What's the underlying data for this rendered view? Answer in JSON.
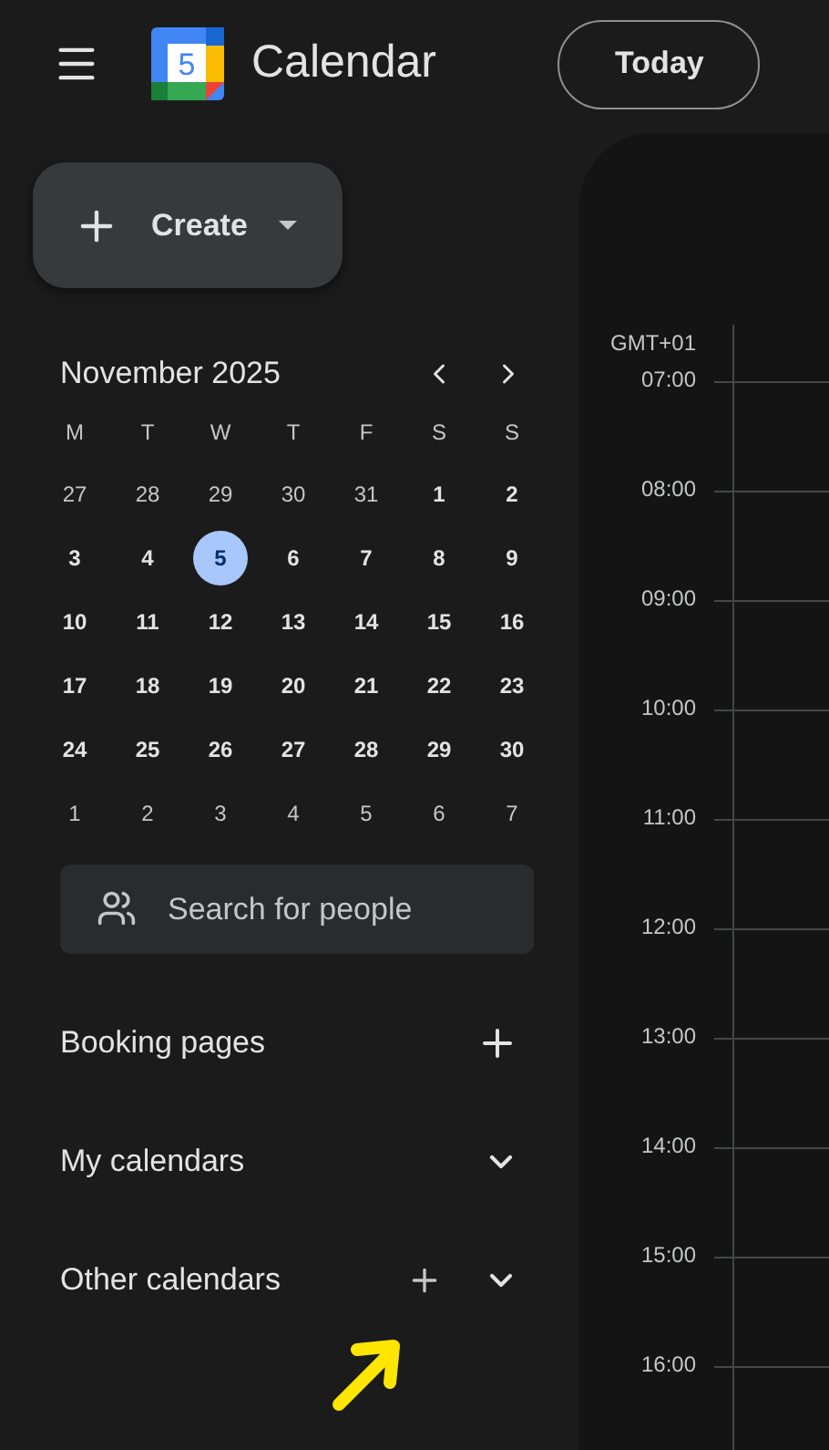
{
  "header": {
    "logo_day": "5",
    "title": "Calendar",
    "today_button": "Today"
  },
  "create_button": {
    "label": "Create"
  },
  "mini_calendar": {
    "title": "November 2025",
    "weekdays": [
      "M",
      "T",
      "W",
      "T",
      "F",
      "S",
      "S"
    ],
    "weeks": [
      [
        {
          "day": "27",
          "in_month": false,
          "selected": false
        },
        {
          "day": "28",
          "in_month": false,
          "selected": false
        },
        {
          "day": "29",
          "in_month": false,
          "selected": false
        },
        {
          "day": "30",
          "in_month": false,
          "selected": false
        },
        {
          "day": "31",
          "in_month": false,
          "selected": false
        },
        {
          "day": "1",
          "in_month": true,
          "selected": false
        },
        {
          "day": "2",
          "in_month": true,
          "selected": false
        }
      ],
      [
        {
          "day": "3",
          "in_month": true,
          "selected": false
        },
        {
          "day": "4",
          "in_month": true,
          "selected": false
        },
        {
          "day": "5",
          "in_month": true,
          "selected": true
        },
        {
          "day": "6",
          "in_month": true,
          "selected": false
        },
        {
          "day": "7",
          "in_month": true,
          "selected": false
        },
        {
          "day": "8",
          "in_month": true,
          "selected": false
        },
        {
          "day": "9",
          "in_month": true,
          "selected": false
        }
      ],
      [
        {
          "day": "10",
          "in_month": true,
          "selected": false
        },
        {
          "day": "11",
          "in_month": true,
          "selected": false
        },
        {
          "day": "12",
          "in_month": true,
          "selected": false
        },
        {
          "day": "13",
          "in_month": true,
          "selected": false
        },
        {
          "day": "14",
          "in_month": true,
          "selected": false
        },
        {
          "day": "15",
          "in_month": true,
          "selected": false
        },
        {
          "day": "16",
          "in_month": true,
          "selected": false
        }
      ],
      [
        {
          "day": "17",
          "in_month": true,
          "selected": false
        },
        {
          "day": "18",
          "in_month": true,
          "selected": false
        },
        {
          "day": "19",
          "in_month": true,
          "selected": false
        },
        {
          "day": "20",
          "in_month": true,
          "selected": false
        },
        {
          "day": "21",
          "in_month": true,
          "selected": false
        },
        {
          "day": "22",
          "in_month": true,
          "selected": false
        },
        {
          "day": "23",
          "in_month": true,
          "selected": false
        }
      ],
      [
        {
          "day": "24",
          "in_month": true,
          "selected": false
        },
        {
          "day": "25",
          "in_month": true,
          "selected": false
        },
        {
          "day": "26",
          "in_month": true,
          "selected": false
        },
        {
          "day": "27",
          "in_month": true,
          "selected": false
        },
        {
          "day": "28",
          "in_month": true,
          "selected": false
        },
        {
          "day": "29",
          "in_month": true,
          "selected": false
        },
        {
          "day": "30",
          "in_month": true,
          "selected": false
        }
      ],
      [
        {
          "day": "1",
          "in_month": false,
          "selected": false
        },
        {
          "day": "2",
          "in_month": false,
          "selected": false
        },
        {
          "day": "3",
          "in_month": false,
          "selected": false
        },
        {
          "day": "4",
          "in_month": false,
          "selected": false
        },
        {
          "day": "5",
          "in_month": false,
          "selected": false
        },
        {
          "day": "6",
          "in_month": false,
          "selected": false
        },
        {
          "day": "7",
          "in_month": false,
          "selected": false
        }
      ]
    ]
  },
  "search": {
    "placeholder": "Search for people"
  },
  "sections": [
    {
      "label": "Booking pages",
      "actions": [
        {
          "kind": "add"
        }
      ]
    },
    {
      "label": "My calendars",
      "actions": [
        {
          "kind": "expand"
        }
      ]
    },
    {
      "label": "Other calendars",
      "actions": [
        {
          "kind": "add"
        },
        {
          "kind": "expand"
        }
      ]
    }
  ],
  "day_view": {
    "timezone": "GMT+01",
    "hours": [
      "07:00",
      "08:00",
      "09:00",
      "10:00",
      "11:00",
      "12:00",
      "13:00",
      "14:00",
      "15:00",
      "16:00"
    ]
  }
}
